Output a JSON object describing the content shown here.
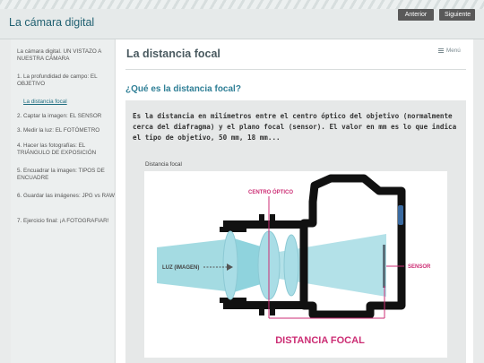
{
  "header": {
    "site_title": "La cámara digital",
    "prev_label": "Anterior",
    "next_label": "Siguiente"
  },
  "sidebar": {
    "items": [
      {
        "label": "La cámara digital. UN VISTAZO A NUESTRA CÁMARA"
      },
      {
        "label": "1. La profundidad de campo: EL OBJETIVO"
      },
      {
        "label": "La distancia focal"
      },
      {
        "label": "2. Captar la imagen: EL SENSOR"
      },
      {
        "label": "3. Medir la luz: EL FOTÓMETRO"
      },
      {
        "label": "4. Hacer las fotografías: EL TRIÁNGULO DE EXPOSICIÓN"
      },
      {
        "label": "5. Encuadrar la imagen: TIPOS DE ENCUADRE"
      },
      {
        "label": "6. Guardar las imágenes: JPG vs RAW"
      },
      {
        "label": "7. Ejercicio final: ¡A FOTOGRAFIAR!"
      }
    ]
  },
  "main": {
    "page_title": "La distancia focal",
    "menu_label": "Menú",
    "section_question": "¿Qué es la distancia focal?",
    "definition": "Es la distancia en milímetros entre el centro óptico del objetivo (normalmente cerca del diafragma) y el plano focal (sensor). El valor en mm es lo que indica el tipo de objetivo, 50 mm, 18 mm...",
    "figure_caption": "Distancia focal",
    "diagram": {
      "optical_center_label": "CENTRO ÓPTICO",
      "light_label": "LUZ (IMAGEN)",
      "sensor_label": "SENSOR",
      "focal_distance_label": "DISTANCIA FOCAL",
      "colors": {
        "body": "#111111",
        "lens": "#a9dde6",
        "light": "#8fd3dd",
        "accent": "#cc2d74"
      }
    }
  }
}
